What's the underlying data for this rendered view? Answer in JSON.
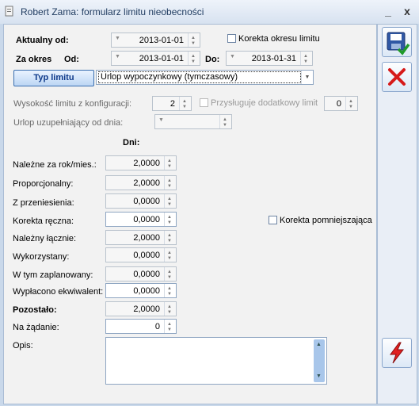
{
  "window": {
    "title": "Robert Zama: formularz limitu nieobecności",
    "minimize": "_",
    "close": "x"
  },
  "header": {
    "aktualny_od_label": "Aktualny od:",
    "aktualny_od_value": "2013-01-01",
    "korekta_okresu_label": "Korekta okresu limitu",
    "za_okres_label": "Za okres",
    "od_label": "Od:",
    "od_value": "2013-01-01",
    "do_label": "Do:",
    "do_value": "2013-01-31",
    "typ_limitu_button": "Typ limitu",
    "typ_limitu_value": "Urlop wypoczynkowy (tymczasowy)"
  },
  "config": {
    "wysokosc_label": "Wysokość limitu z konfiguracji:",
    "wysokosc_value": "2",
    "przysluguje_label": "Przysługuje dodatkowy limit",
    "przysluguje_value": "0",
    "urlop_uzup_label": "Urlop uzupełniający od dnia:"
  },
  "days": {
    "header": "Dni:",
    "rows": [
      {
        "label": "Należne za rok/mies.:",
        "value": "2,0000"
      },
      {
        "label": "Proporcjonalny:",
        "value": "2,0000"
      },
      {
        "label": "Z przeniesienia:",
        "value": "0,0000"
      },
      {
        "label": "Korekta ręczna:",
        "value": "0,0000"
      },
      {
        "label": "Należny łącznie:",
        "value": "2,0000"
      },
      {
        "label": "Wykorzystany:",
        "value": "0,0000"
      },
      {
        "label": "W tym zaplanowany:",
        "value": "0,0000"
      },
      {
        "label": "Wypłacono ekwiwalent:",
        "value": "0,0000"
      },
      {
        "label": "Pozostało:",
        "value": "2,0000"
      },
      {
        "label": "Na żądanie:",
        "value": "0"
      }
    ],
    "korekta_pomniejszajaca_label": "Korekta pomniejszająca",
    "opis_label": "Opis:"
  }
}
